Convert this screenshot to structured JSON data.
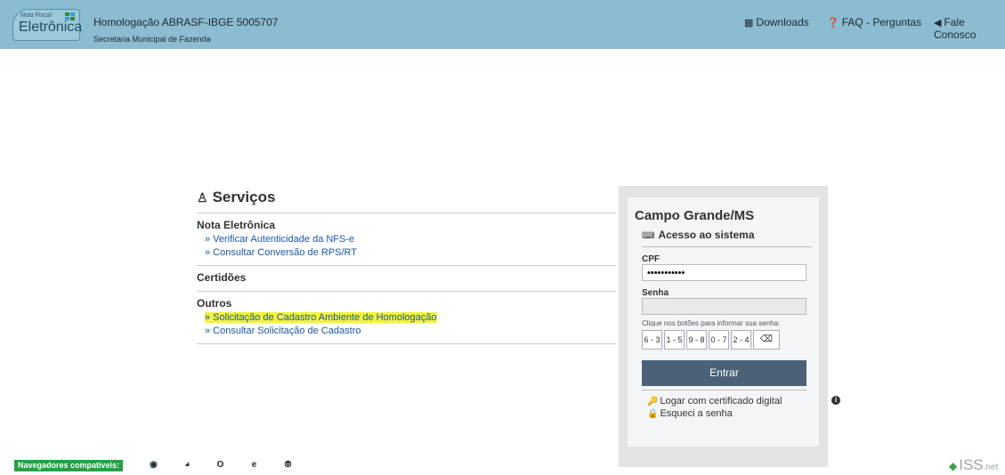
{
  "header": {
    "logo_small": "Nota Fiscal",
    "logo_big": "Eletrônica",
    "env_title": "Homologação ABRASF-IBGE 5005707",
    "env_sub": "Secretaria Municipal de Fazenda",
    "links": [
      {
        "label": "Downloads",
        "icon": "download-icon"
      },
      {
        "label": "FAQ - Perguntas",
        "icon": "question-icon"
      },
      {
        "label": "Fale Conosco",
        "icon": "megaphone-icon"
      }
    ]
  },
  "services": {
    "title": "Serviços",
    "sections": [
      {
        "heading": "Nota Eletrônica",
        "links": [
          "» Verificar Autenticidade da NFS-e",
          "» Consultar Conversão de RPS/RT"
        ]
      },
      {
        "heading": "Certidões",
        "links": []
      },
      {
        "heading": "Outros",
        "links": [
          "» Solicitação de Cadastro Ambiente de Homologação",
          "» Consultar Solicitação de Cadastro"
        ]
      }
    ]
  },
  "login": {
    "city": "Campo Grande/MS",
    "access": "Acesso ao sistema",
    "cpf_label": "CPF",
    "cpf_value": "•••••••••••",
    "senha_label": "Senha",
    "senha_value": "",
    "hint": "Clique nos botões para informar sua senha:",
    "keys": [
      "6 - 3",
      "1 - 5",
      "9 - 8",
      "0 - 7",
      "2 - 4"
    ],
    "backspace": "⌫",
    "enter": "Entrar",
    "cert": "Logar com certificado digital",
    "forgot": "Esqueci a senha"
  },
  "footer": {
    "browsers_label": "Navegadores compatíveis:",
    "browsers": [
      "chrome-icon",
      "firefox-icon",
      "opera-icon",
      "ie-icon",
      "safari-icon"
    ],
    "brand": "ISS",
    "brand_suffix": ".net"
  },
  "colors": {
    "topbar": "#8bbcd1",
    "link": "#1a56a8",
    "highlight": "#f3f23c",
    "enter_button": "#4a6178",
    "browsers_badge": "#27a045"
  }
}
